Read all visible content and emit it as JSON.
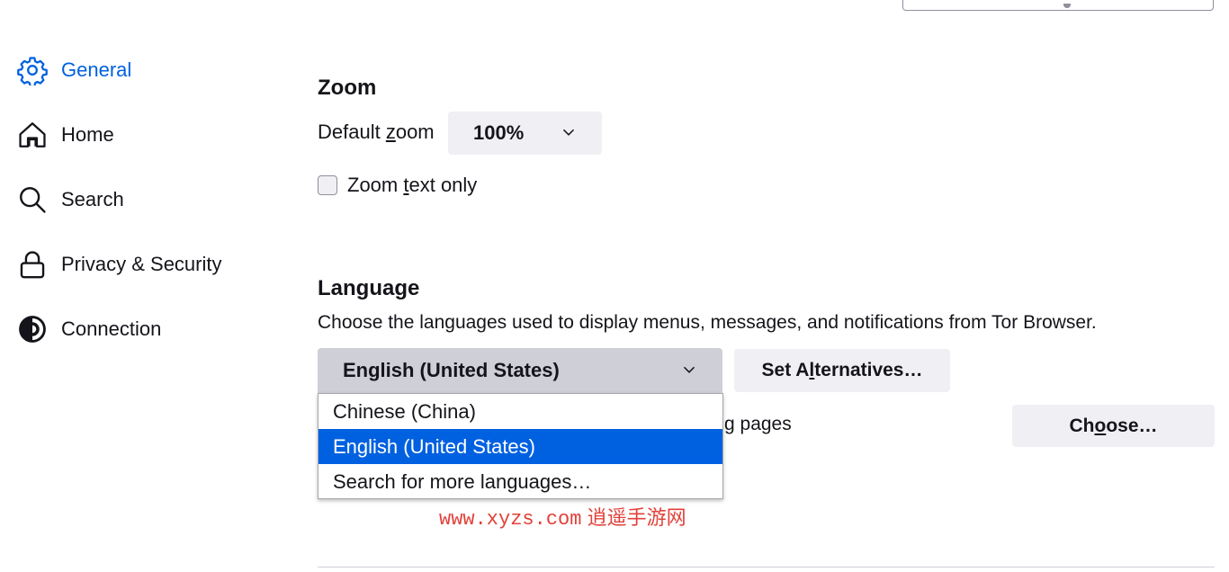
{
  "sidebar": {
    "items": [
      {
        "label": "General",
        "icon": "gear-icon",
        "selected": true
      },
      {
        "label": "Home",
        "icon": "home-icon",
        "selected": false
      },
      {
        "label": "Search",
        "icon": "search-icon",
        "selected": false
      },
      {
        "label": "Privacy & Security",
        "icon": "lock-icon",
        "selected": false
      },
      {
        "label": "Connection",
        "icon": "onion-icon",
        "selected": false
      }
    ]
  },
  "zoom": {
    "heading": "Zoom",
    "default_zoom_label_pre": "Default ",
    "default_zoom_label_key": "z",
    "default_zoom_label_post": "oom",
    "default_zoom_value": "100%",
    "text_only_pre": "Zoom ",
    "text_only_key": "t",
    "text_only_post": "ext only",
    "text_only_checked": false
  },
  "language": {
    "heading": "Language",
    "description": "Choose the languages used to display menus, messages, and notifications from Tor Browser.",
    "selected": "English (United States)",
    "set_alternatives_pre": "Set A",
    "set_alternatives_key": "l",
    "set_alternatives_post": "ternatives…",
    "options": [
      "Chinese (China)",
      "English (United States)",
      "Search for more languages…"
    ],
    "highlighted_index": 1,
    "pages_text_fragment": "g pages",
    "choose_pre": "Ch",
    "choose_key": "o",
    "choose_post": "ose…"
  },
  "watermark": {
    "url": "www.xyzs.com",
    "name": "逍遥手游网"
  },
  "colors": {
    "accent": "#0061e0",
    "button_bg": "#f0f0f4",
    "select_active_bg": "#cfcfd8",
    "watermark": "#e0413a"
  }
}
